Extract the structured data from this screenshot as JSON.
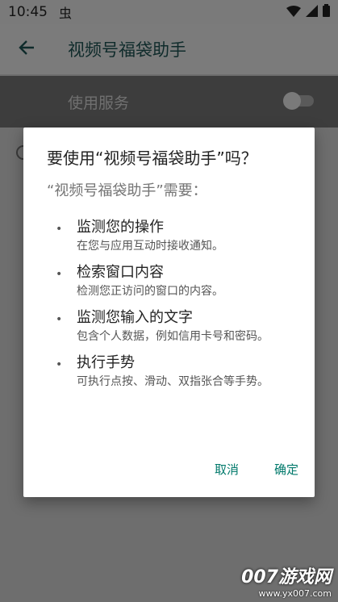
{
  "status_bar": {
    "time": "10:45",
    "app_glyph": "虫",
    "icons": [
      "wifi-icon",
      "signal-icon",
      "battery-icon"
    ]
  },
  "toolbar": {
    "title": "视频号福袋助手",
    "back_icon": "back-arrow-icon"
  },
  "service": {
    "label": "使用服务",
    "enabled": false
  },
  "dialog": {
    "title": "要使用“视频号福袋助手”吗？",
    "subtitle": "“视频号福袋助手”需要：",
    "permissions": [
      {
        "bullet": "•",
        "title": "监测您的操作",
        "desc": "在您与应用互动时接收通知。"
      },
      {
        "bullet": "•",
        "title": "检索窗口内容",
        "desc": "检测您正访问的窗口的内容。"
      },
      {
        "bullet": "•",
        "title": "监测您输入的文字",
        "desc": "包含个人数据，例如信用卡号和密码。"
      },
      {
        "bullet": "•",
        "title": "执行手势",
        "desc": "可执行点按、滑动、双指张合等手势。"
      }
    ],
    "cancel_label": "取消",
    "ok_label": "确定"
  },
  "watermark": {
    "main": "007游戏网",
    "url": "www.yx007.com"
  },
  "colors": {
    "accent": "#00796b",
    "scrim": "#6e6e6e",
    "dialog_bg": "#ffffff"
  }
}
